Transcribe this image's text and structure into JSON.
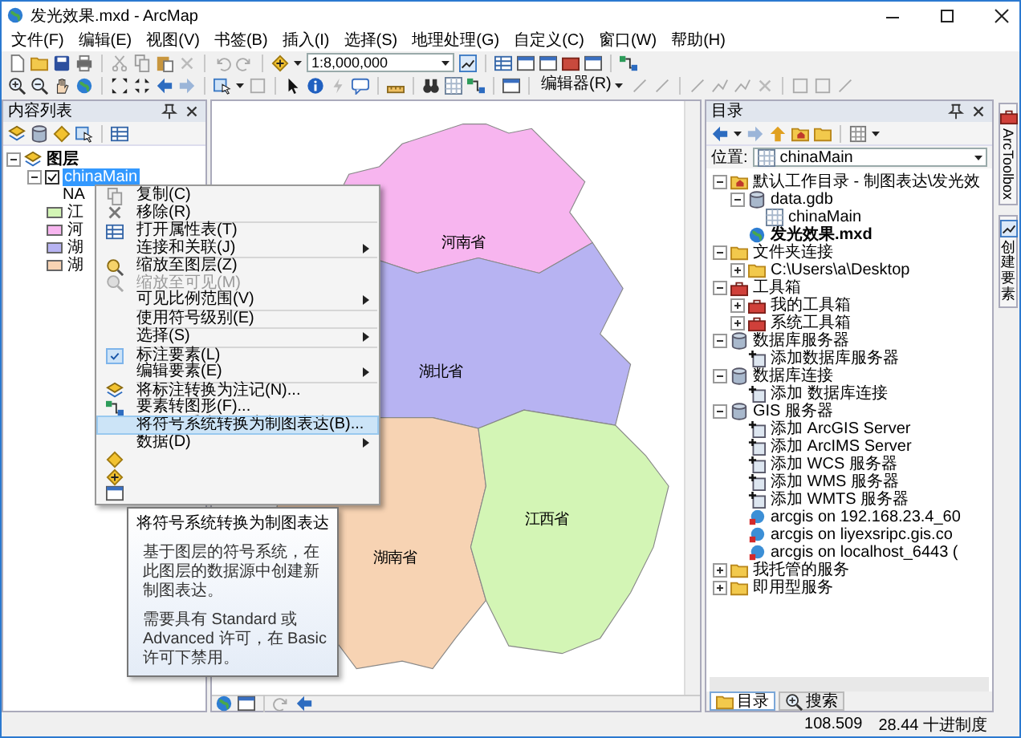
{
  "window": {
    "title": "发光效果.mxd - ArcMap"
  },
  "menu": [
    "文件(F)",
    "编辑(E)",
    "视图(V)",
    "书签(B)",
    "插入(I)",
    "选择(S)",
    "地理处理(G)",
    "自定义(C)",
    "窗口(W)",
    "帮助(H)"
  ],
  "toolbar": {
    "scale": "1:8,000,000",
    "editor": "编辑器(R)"
  },
  "toc": {
    "title": "内容列表",
    "tree": [
      {
        "label": "图层",
        "expanded": true,
        "children": [
          {
            "label": "chinaMain",
            "expanded": true,
            "checked": true,
            "selected": true,
            "field": "NA",
            "legend": [
              {
                "label": "江",
                "color": "#d3f5b5"
              },
              {
                "label": "河",
                "color": "#f7b5ef"
              },
              {
                "label": "湖",
                "color": "#b7b3f2"
              },
              {
                "label": "湖",
                "color": "#f7d3b3"
              }
            ]
          }
        ]
      }
    ]
  },
  "context_menu": [
    {
      "kind": "item",
      "label": "复制(C)",
      "disabled": false,
      "checked": false,
      "submenu": false,
      "selected": false
    },
    {
      "kind": "item",
      "label": "移除(R)",
      "disabled": false,
      "checked": false,
      "submenu": false,
      "selected": false
    },
    {
      "kind": "separator"
    },
    {
      "kind": "item",
      "label": "打开属性表(T)",
      "disabled": false,
      "checked": false,
      "submenu": false,
      "selected": false
    },
    {
      "kind": "item",
      "label": "连接和关联(J)",
      "disabled": false,
      "checked": false,
      "submenu": true,
      "selected": false
    },
    {
      "kind": "separator"
    },
    {
      "kind": "item",
      "label": "缩放至图层(Z)",
      "disabled": false,
      "checked": false,
      "submenu": false,
      "selected": false
    },
    {
      "kind": "item",
      "label": "缩放至可见(M)",
      "disabled": true,
      "checked": false,
      "submenu": false,
      "selected": false
    },
    {
      "kind": "item",
      "label": "可见比例范围(V)",
      "disabled": false,
      "checked": false,
      "submenu": true,
      "selected": false
    },
    {
      "kind": "separator"
    },
    {
      "kind": "item",
      "label": "使用符号级别(E)",
      "disabled": false,
      "checked": false,
      "submenu": false,
      "selected": false
    },
    {
      "kind": "separator"
    },
    {
      "kind": "item",
      "label": "选择(S)",
      "disabled": false,
      "checked": false,
      "submenu": true,
      "selected": false
    },
    {
      "kind": "separator"
    },
    {
      "kind": "item",
      "label": "标注要素(L)",
      "disabled": false,
      "checked": true,
      "submenu": false,
      "selected": false
    },
    {
      "kind": "item",
      "label": "编辑要素(E)",
      "disabled": false,
      "checked": false,
      "submenu": true,
      "selected": false
    },
    {
      "kind": "separator"
    },
    {
      "kind": "item",
      "label": "将标注转换为注记(N)...",
      "disabled": false,
      "checked": false,
      "submenu": false,
      "selected": false
    },
    {
      "kind": "item",
      "label": "要素转图形(F)...",
      "disabled": false,
      "checked": false,
      "submenu": false,
      "selected": false
    },
    {
      "kind": "item",
      "label": "将符号系统转换为制图表达(B)...",
      "disabled": false,
      "checked": false,
      "submenu": false,
      "selected": true
    },
    {
      "kind": "separator"
    },
    {
      "kind": "item",
      "label": "数据(D)",
      "disabled": false,
      "checked": false,
      "submenu": true,
      "selected": false
    },
    {
      "kind": "item"
    },
    {
      "kind": "item"
    },
    {
      "kind": "item"
    }
  ],
  "tooltip": {
    "title": "将符号系统转换为制图表达",
    "paragraphs": [
      "基于图层的符号系统，在此图层的数据源中创建新制图表达。",
      "需要具有 Standard 或 Advanced 许可，在 Basic 许可下禁用。"
    ]
  },
  "map": {
    "regions": [
      {
        "label": "河南省",
        "color": "#f7b5ef"
      },
      {
        "label": "湖北省",
        "color": "#b7b3f2"
      },
      {
        "label": "湖南省",
        "color": "#f7d3b3"
      },
      {
        "label": "江西省",
        "color": "#d3f5b5"
      }
    ]
  },
  "catalog": {
    "title": "目录",
    "location_label": "位置:",
    "location": "chinaMain",
    "tree": [
      {
        "label": "默认工作目录 - 制图表达\\发光效",
        "kind": "home",
        "expanded": true,
        "children": [
          {
            "label": "data.gdb",
            "kind": "gdb",
            "expanded": true,
            "children": [
              {
                "label": "chinaMain",
                "kind": "fc"
              }
            ]
          },
          {
            "label": "发光效果.mxd",
            "kind": "mxd",
            "bold": true
          }
        ]
      },
      {
        "label": "文件夹连接",
        "kind": "folder",
        "expanded": true,
        "children": [
          {
            "label": "C:\\Users\\a\\Desktop",
            "kind": "folder",
            "expanded": false
          }
        ]
      },
      {
        "label": "工具箱",
        "kind": "toolbox",
        "expanded": true,
        "children": [
          {
            "label": "我的工具箱",
            "kind": "toolbox",
            "expanded": false
          },
          {
            "label": "系统工具箱",
            "kind": "toolbox",
            "expanded": false
          }
        ]
      },
      {
        "label": "数据库服务器",
        "kind": "gdb",
        "expanded": true,
        "children": [
          {
            "label": "添加数据库服务器",
            "kind": "add"
          }
        ]
      },
      {
        "label": "数据库连接",
        "kind": "gdb",
        "expanded": true,
        "children": [
          {
            "label": "添加 数据库连接",
            "kind": "add"
          }
        ]
      },
      {
        "label": "GIS 服务器",
        "kind": "gdb",
        "expanded": true,
        "children": [
          {
            "label": "添加 ArcGIS Server",
            "kind": "add"
          },
          {
            "label": "添加 ArcIMS Server",
            "kind": "add"
          },
          {
            "label": "添加 WCS 服务器",
            "kind": "add"
          },
          {
            "label": "添加 WMS 服务器",
            "kind": "add"
          },
          {
            "label": "添加 WMTS 服务器",
            "kind": "add"
          },
          {
            "label": "arcgis on 192.168.23.4_60",
            "kind": "server"
          },
          {
            "label": "arcgis on liyexsripc.gis.co",
            "kind": "server"
          },
          {
            "label": "arcgis on localhost_6443 (",
            "kind": "server"
          }
        ]
      },
      {
        "label": "我托管的服务",
        "kind": "folder",
        "expanded": false
      },
      {
        "label": "即用型服务",
        "kind": "folder",
        "expanded": false
      }
    ],
    "tabs": [
      {
        "label": "目录",
        "selected": true
      },
      {
        "label": "搜索",
        "selected": false
      }
    ]
  },
  "side_tabs": [
    "ArcToolbox",
    "创建要素"
  ],
  "status_bar": [
    "108.509",
    "28.44 十进制度"
  ]
}
